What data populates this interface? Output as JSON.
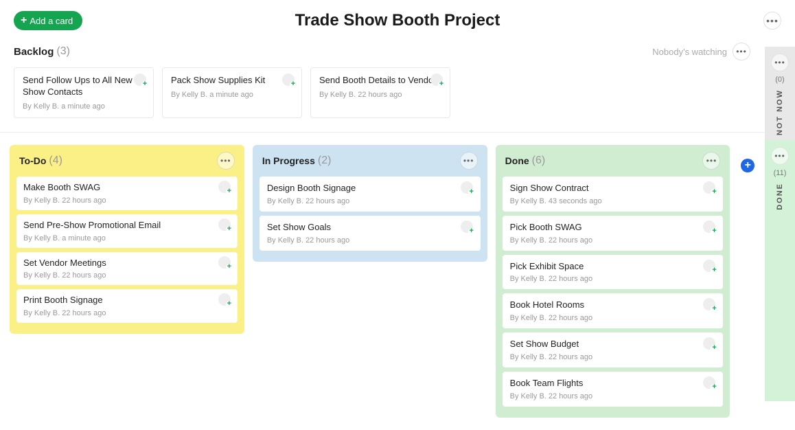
{
  "header": {
    "add_card_label": "Add a card",
    "title": "Trade Show Booth Project"
  },
  "backlog": {
    "title": "Backlog",
    "count": "(3)",
    "watching": "Nobody's watching",
    "cards": [
      {
        "title": "Send Follow Ups to All New Show Contacts",
        "meta": "By Kelly B. a minute ago"
      },
      {
        "title": "Pack Show Supplies Kit",
        "meta": "By Kelly B. a minute ago"
      },
      {
        "title": "Send Booth Details to Vendors",
        "meta": "By Kelly B. 22 hours ago"
      }
    ]
  },
  "columns": {
    "todo": {
      "title": "To-Do",
      "count": "(4)",
      "cards": [
        {
          "title": "Make Booth SWAG",
          "meta": "By Kelly B. 22 hours ago"
        },
        {
          "title": "Send Pre-Show Promotional Email",
          "meta": "By Kelly B. a minute ago"
        },
        {
          "title": "Set Vendor Meetings",
          "meta": "By Kelly B. 22 hours ago"
        },
        {
          "title": "Print Booth Signage",
          "meta": "By Kelly B. 22 hours ago"
        }
      ]
    },
    "inprogress": {
      "title": "In Progress",
      "count": "(2)",
      "cards": [
        {
          "title": "Design Booth Signage",
          "meta": "By Kelly B. 22 hours ago"
        },
        {
          "title": "Set Show Goals",
          "meta": "By Kelly B. 22 hours ago"
        }
      ]
    },
    "done": {
      "title": "Done",
      "count": "(6)",
      "cards": [
        {
          "title": "Sign Show Contract",
          "meta": "By Kelly B. 43 seconds ago"
        },
        {
          "title": "Pick Booth SWAG",
          "meta": "By Kelly B. 22 hours ago"
        },
        {
          "title": "Pick Exhibit Space",
          "meta": "By Kelly B. 22 hours ago"
        },
        {
          "title": "Book Hotel Rooms",
          "meta": "By Kelly B. 22 hours ago"
        },
        {
          "title": "Set Show Budget",
          "meta": "By Kelly B. 22 hours ago"
        },
        {
          "title": "Book Team Flights",
          "meta": "By Kelly B. 22 hours ago"
        }
      ]
    }
  },
  "rails": {
    "notnow": {
      "count": "(0)",
      "label": "NOT NOW"
    },
    "done": {
      "count": "(11)",
      "label": "DONE"
    }
  }
}
